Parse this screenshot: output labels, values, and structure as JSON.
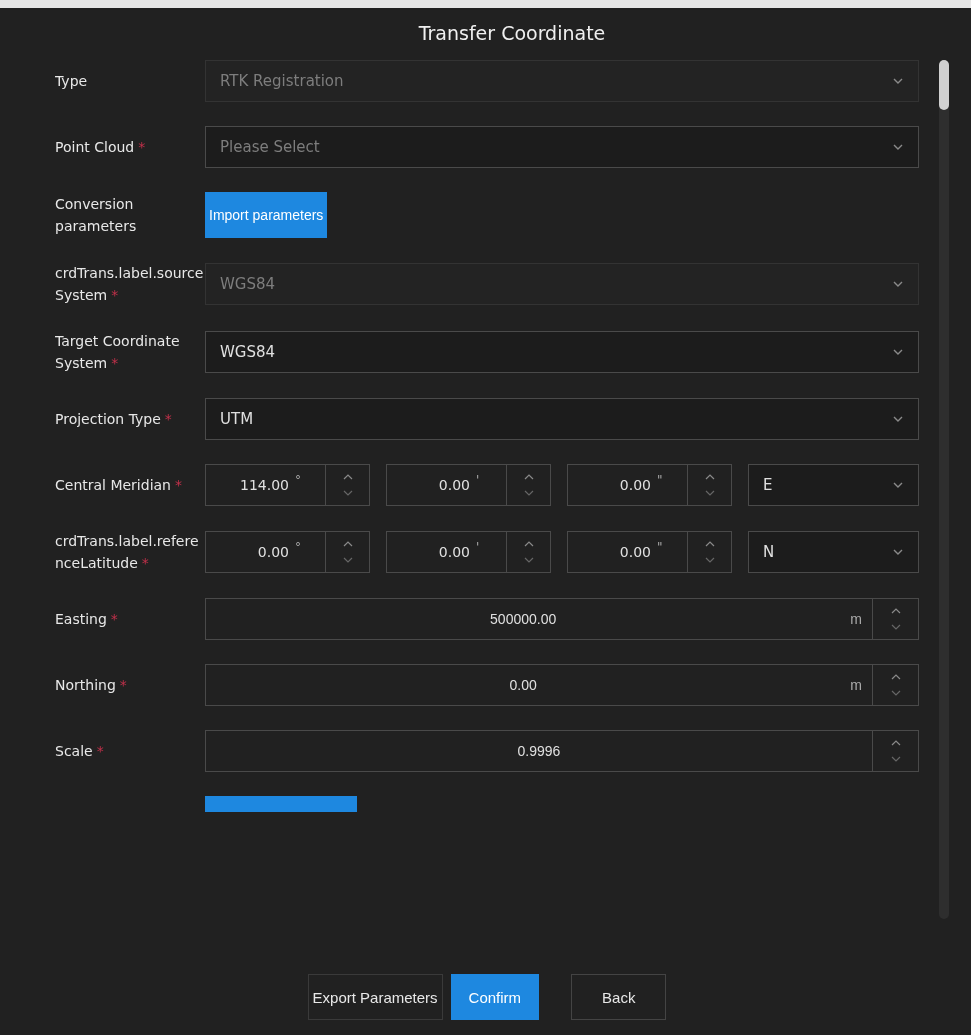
{
  "dialog": {
    "title": "Transfer Coordinate"
  },
  "form": {
    "rows": [
      {
        "kind": "select",
        "label": "Type",
        "value": "RTK Registration",
        "disabled": true
      },
      {
        "kind": "select",
        "label": "Point Cloud",
        "asterisk": "*",
        "placeholder": "Please Select",
        "disabled": false
      },
      {
        "kind": "button",
        "label": "Conversion parameters",
        "button": "Import parameters"
      },
      {
        "kind": "select",
        "label": "crdTrans.label.sourceSystem",
        "asterisk": "*",
        "value": "WGS84",
        "disabled": true
      },
      {
        "kind": "select",
        "label": "Target Coordinate System",
        "asterisk": "*",
        "value": "WGS84",
        "disabled": false
      },
      {
        "kind": "select",
        "label": "Projection Type",
        "asterisk": "*",
        "value": "UTM",
        "disabled": false
      },
      {
        "kind": "dms",
        "label": "Central Meridian",
        "asterisk": "*",
        "parts": [
          {
            "value": "114.00",
            "unit": "°"
          },
          {
            "value": "0.00",
            "unit": "'"
          },
          {
            "value": "0.00",
            "unit": "\""
          }
        ],
        "hemisphere": "E"
      },
      {
        "kind": "dms",
        "label": "crdTrans.label.referenceLatitude",
        "asterisk": "*",
        "parts": [
          {
            "value": "0.00",
            "unit": "°"
          },
          {
            "value": "0.00",
            "unit": "'"
          },
          {
            "value": "0.00",
            "unit": "\""
          }
        ],
        "hemisphere": "N"
      },
      {
        "kind": "number",
        "label": "Easting",
        "asterisk": "*",
        "value": "500000.00",
        "unit": "m"
      },
      {
        "kind": "number",
        "label": "Northing",
        "asterisk": "*",
        "value": "0.00",
        "unit": "m"
      },
      {
        "kind": "number",
        "label": "Scale",
        "asterisk": "*",
        "value": "0.9996"
      },
      {
        "kind": "cut"
      }
    ]
  },
  "footer": {
    "buttons": [
      {
        "label": "Export Parameters",
        "kind": "plain"
      },
      {
        "label": "Confirm",
        "kind": "primary"
      },
      {
        "label": "Back",
        "kind": "outline"
      }
    ]
  }
}
